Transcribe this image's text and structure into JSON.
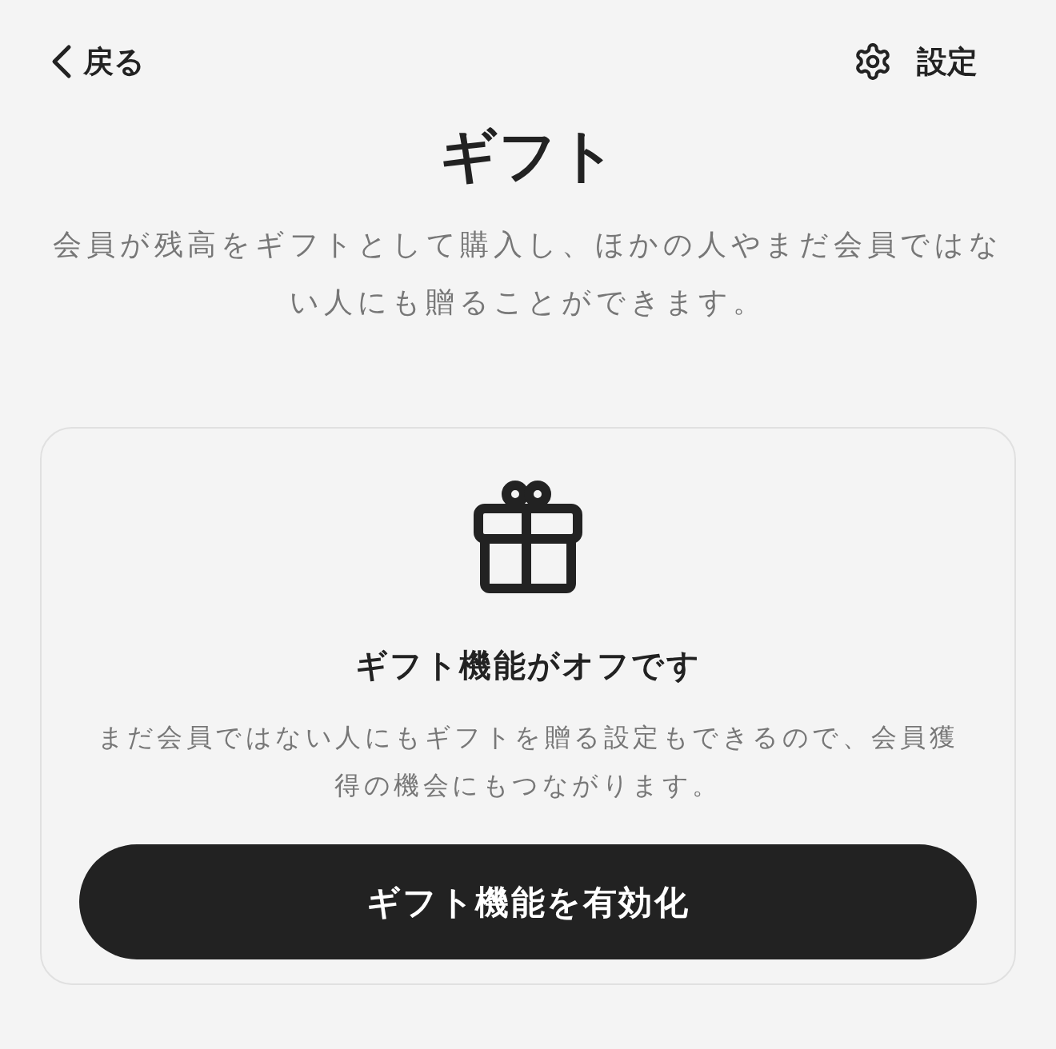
{
  "header": {
    "back_label": "戻る",
    "settings_label": "設定"
  },
  "title": "ギフト",
  "description": "会員が残高をギフトとして購入し、ほかの人やまだ会員ではない人にも贈ることができます。",
  "status_card": {
    "heading": "ギフト機能がオフです",
    "body": "まだ会員ではない人にもギフトを贈る設定もできるので、会員獲得の機会にもつながります。",
    "button": "ギフト機能を有効化"
  }
}
